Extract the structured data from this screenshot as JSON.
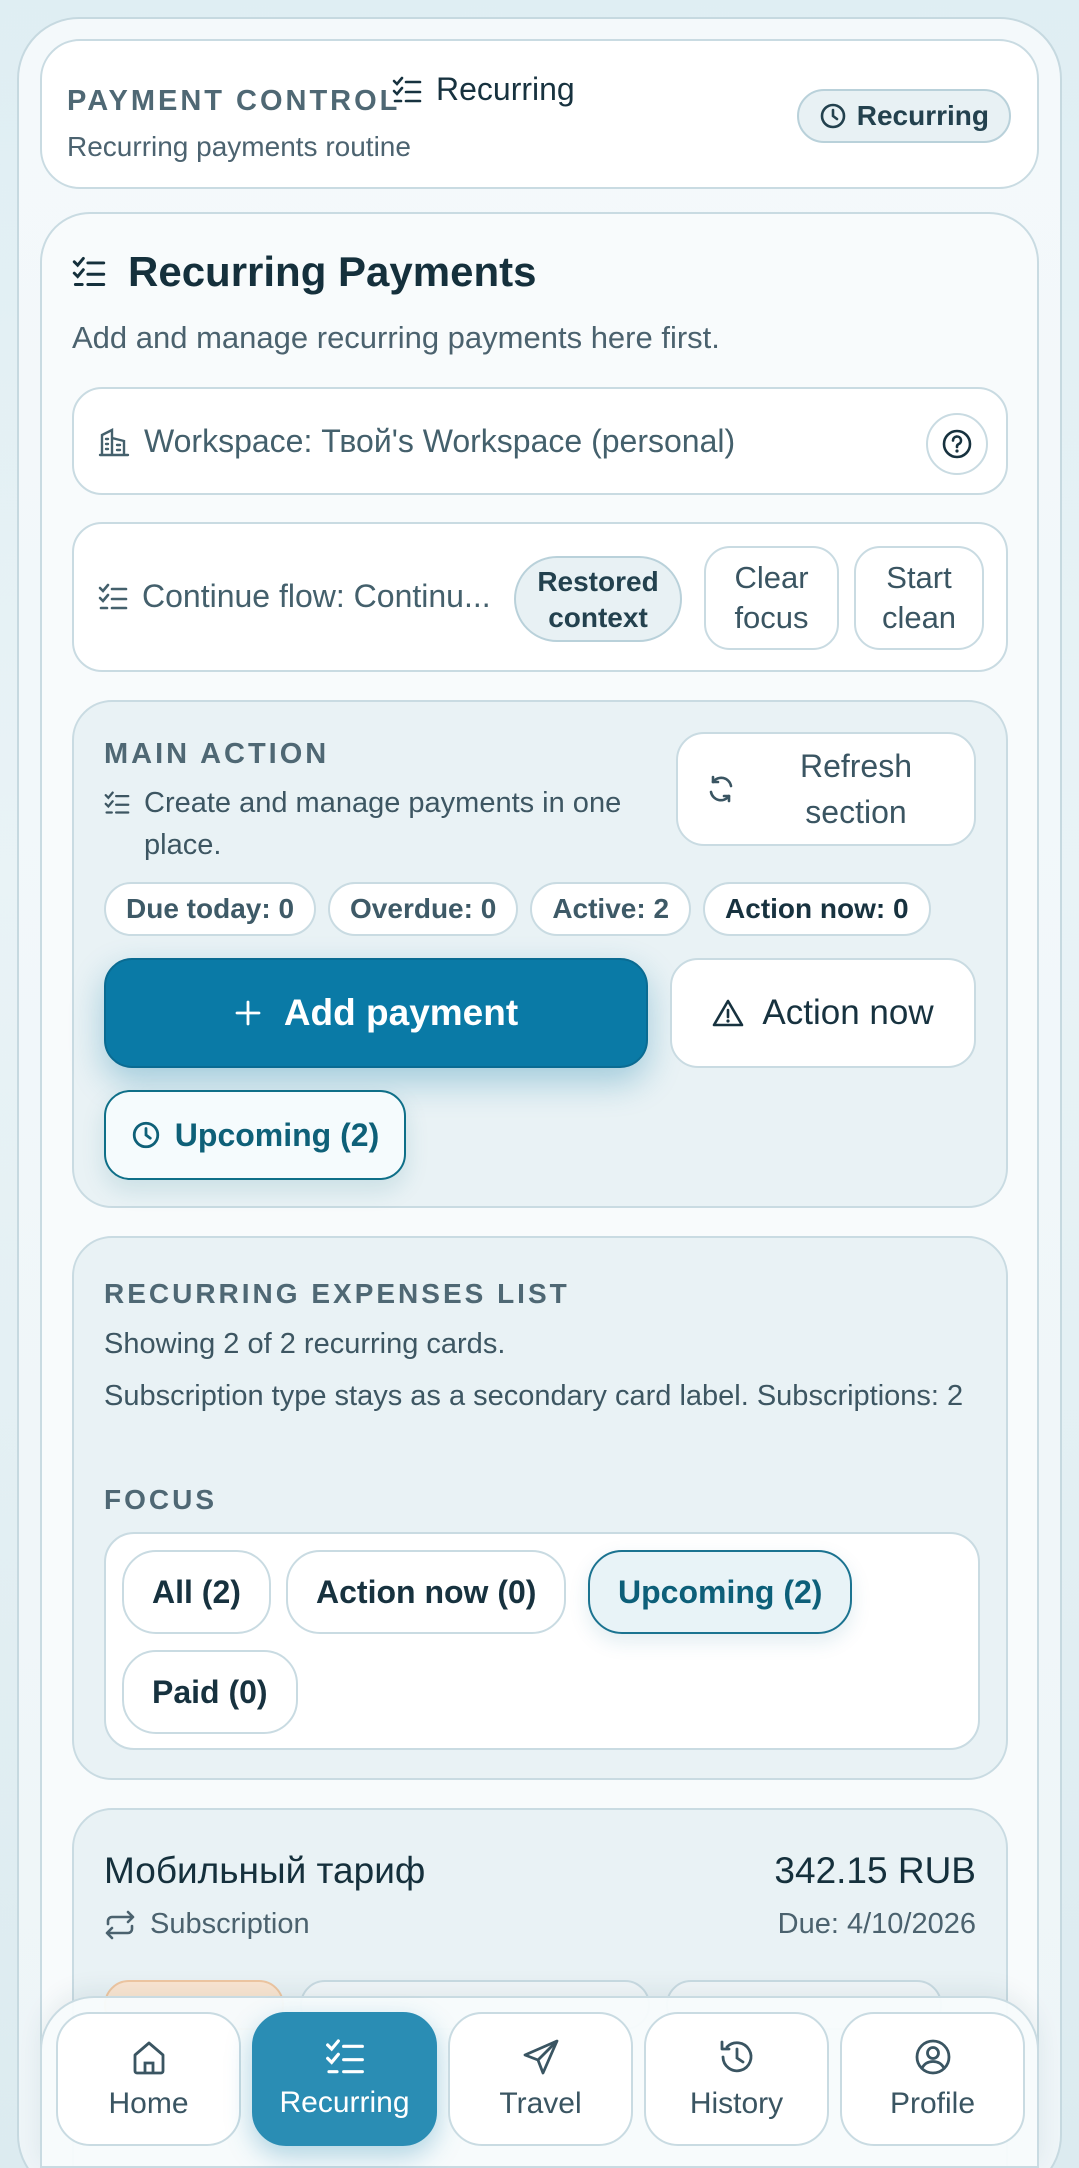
{
  "header": {
    "eyebrow": "PAYMENT CONTROL",
    "subtitle": "Recurring payments routine",
    "crumb": "Recurring",
    "badge": "Recurring"
  },
  "main": {
    "title": "Recurring Payments",
    "description": "Add and manage recurring payments here first.",
    "workspace": "Workspace: Твой's Workspace (personal)",
    "flow_label": "Continue flow: Continu...",
    "restored_badge": "Restored context",
    "clear_focus": "Clear focus",
    "start_clean": "Start clean"
  },
  "action": {
    "eyebrow": "MAIN ACTION",
    "description": "Create and manage payments in one place.",
    "refresh": "Refresh section",
    "chips": [
      "Due today: 0",
      "Overdue: 0",
      "Active: 2",
      "Action now: 0"
    ],
    "add_payment": "Add payment",
    "action_now": "Action now",
    "upcoming": "Upcoming (2)"
  },
  "list": {
    "eyebrow": "RECURRING EXPENSES LIST",
    "showing": "Showing 2 of 2 recurring cards.",
    "note": "Subscription type stays as a secondary card label. Subscriptions: 2",
    "focus_eyebrow": "FOCUS",
    "focus": [
      "All (2)",
      "Action now (0)",
      "Upcoming (2)",
      "Paid (0)"
    ]
  },
  "payment": {
    "name": "Мобильный тариф",
    "type": "Subscription",
    "amount": "342.15 RUB",
    "due": "Due: 4/10/2026"
  },
  "nav": [
    "Home",
    "Recurring",
    "Travel",
    "History",
    "Profile"
  ],
  "colors": {
    "primary": "#0a7aa6",
    "nav_active": "#2a8db4",
    "text": "#17323f"
  }
}
